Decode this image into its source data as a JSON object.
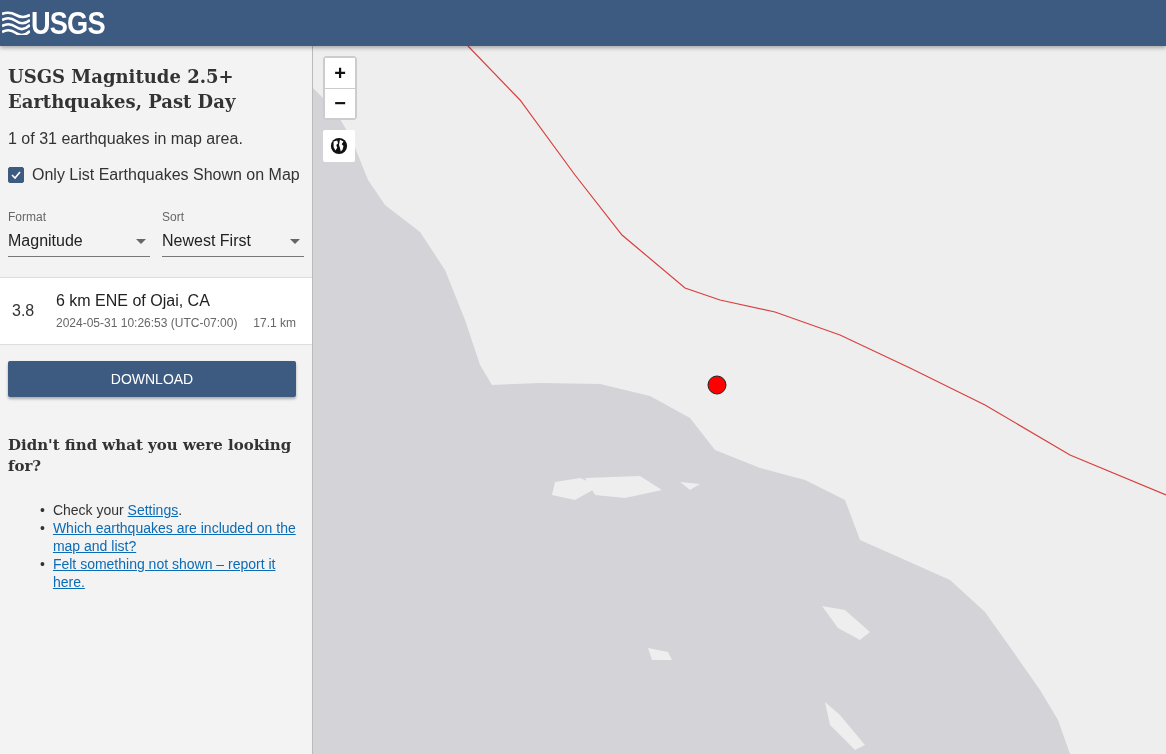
{
  "header": {
    "logo": "USGS"
  },
  "sidebar": {
    "title": "USGS Magnitude 2.5+ Earthquakes, Past Day",
    "count": "1 of 31 earthquakes in map area.",
    "filter": {
      "label": "Only List Earthquakes Shown on Map",
      "checked": true
    },
    "selects": [
      {
        "label": "Format",
        "value": "Magnitude"
      },
      {
        "label": "Sort",
        "value": "Newest First"
      }
    ],
    "earthquakes": [
      {
        "magnitude": "3.8",
        "place": "6 km ENE of Ojai, CA",
        "time": "2024-05-31 10:26:53 (UTC-07:00)",
        "depth": "17.1 km",
        "selected": false
      }
    ],
    "download": "DOWNLOAD",
    "help_title": "Didn't find what you were looking for?",
    "help_items": [
      {
        "marker": "•",
        "text": "Check your ",
        "link": "Settings",
        "after": "."
      },
      {
        "marker": "•",
        "link": "Which earthquakes are included on the map and list?"
      },
      {
        "marker": "•",
        "link": "Felt something not shown – report it here."
      }
    ]
  },
  "map": {
    "zoom_in": "+",
    "zoom_out": "−"
  }
}
